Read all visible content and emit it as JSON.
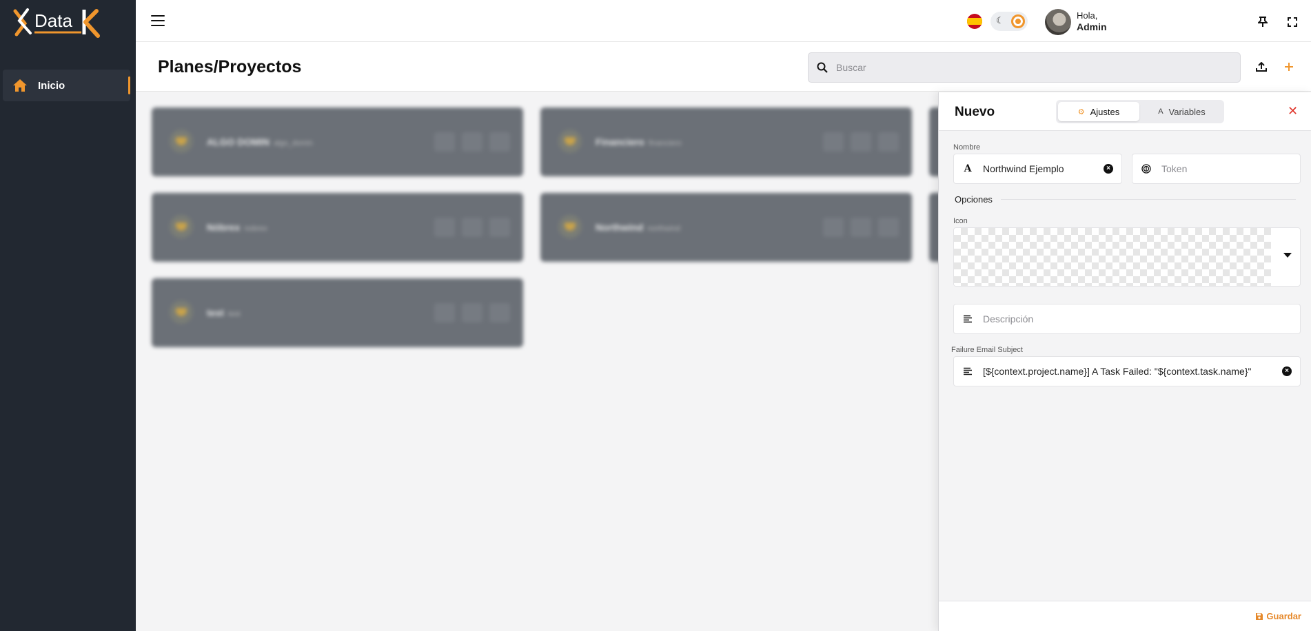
{
  "app": {
    "logo_text": "Data K"
  },
  "sidebar": {
    "items": [
      {
        "label": "Inicio",
        "icon": "home-icon"
      }
    ]
  },
  "topbar": {
    "greeting": "Hola,",
    "user": "Admin",
    "language_flag": "flag-es-icon"
  },
  "page": {
    "title": "Planes/Proyectos",
    "search_placeholder": "Buscar"
  },
  "cards": [
    {
      "name": "ALGO DOMIN",
      "subtitle": "algo_domin"
    },
    {
      "name": "Financiero",
      "subtitle": "financiero"
    },
    {
      "name": "Nóbrex",
      "subtitle": "nobrex"
    },
    {
      "name": "Northwind",
      "subtitle": "northwind"
    },
    {
      "name": "test",
      "subtitle": "test"
    }
  ],
  "drawer": {
    "title": "Nuevo",
    "tabs": [
      {
        "label": "Ajustes",
        "active": true
      },
      {
        "label": "Variables",
        "active": false
      }
    ],
    "nombre_label": "Nombre",
    "nombre_value": "Northwind Ejemplo",
    "token_placeholder": "Token",
    "opciones_label": "Opciones",
    "icon_label": "Icon",
    "descripcion_placeholder": "Descripción",
    "failure_label": "Failure Email Subject",
    "failure_value": "[${context.project.name}] A Task Failed: \"${context.task.name}\"",
    "save_label": "Guardar"
  },
  "colors": {
    "accent": "#f0962d",
    "sidebar_bg": "#222831",
    "close": "#e0362c"
  }
}
